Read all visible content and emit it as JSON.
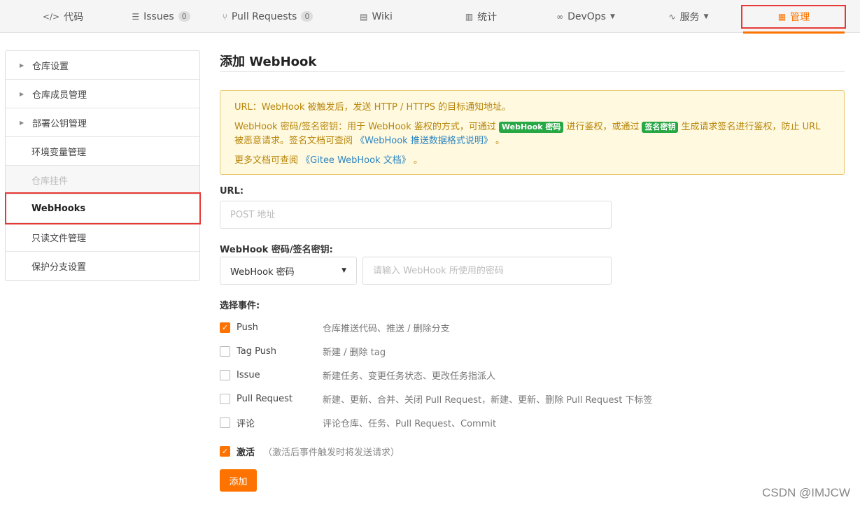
{
  "nav": {
    "items": [
      {
        "icon": "code-icon",
        "glyph": "</>",
        "label": "代码"
      },
      {
        "icon": "issues-icon",
        "glyph": "☰",
        "label": "Issues",
        "badge": "0"
      },
      {
        "icon": "pull-request-icon",
        "glyph": "⑂",
        "label": "Pull Requests",
        "badge": "0"
      },
      {
        "icon": "wiki-icon",
        "glyph": "▤",
        "label": "Wiki"
      },
      {
        "icon": "stats-icon",
        "glyph": "▥",
        "label": "统计"
      },
      {
        "icon": "devops-icon",
        "glyph": "∞",
        "label": "DevOps"
      },
      {
        "icon": "service-icon",
        "glyph": "∿",
        "label": "服务"
      },
      {
        "icon": "manage-icon",
        "glyph": "▦",
        "label": "管理"
      }
    ],
    "active": "管理"
  },
  "sidebar": {
    "items": [
      {
        "label": "仓库设置"
      },
      {
        "label": "仓库成员管理"
      },
      {
        "label": "部署公钥管理"
      },
      {
        "label": "环境变量管理"
      },
      {
        "label": "仓库挂件"
      },
      {
        "label": "WebHooks"
      },
      {
        "label": "只读文件管理"
      },
      {
        "label": "保护分支设置"
      }
    ]
  },
  "main": {
    "title": "添加 WebHook",
    "notice": {
      "line1": "URL：WebHook 被触发后，发送 HTTP / HTTPS 的目标通知地址。",
      "line2_a": "WebHook 密码/签名密钥：用于 WebHook 鉴权的方式，可通过",
      "tag1": "WebHook 密码",
      "line2_b": "进行鉴权，或通过",
      "tag2": "签名密钥",
      "line2_c": "生成请求签名进行鉴权，防止 URL 被恶意请求。签名文档可查阅",
      "link1": "《WebHook 推送数据格式说明》",
      "line2_d": "。",
      "line3_a": "更多文档可查阅",
      "link2": "《Gitee WebHook 文档》",
      "line3_b": "。"
    },
    "url_label": "URL:",
    "url_placeholder": "POST 地址",
    "secret_label": "WebHook 密码/签名密钥:",
    "secret_type": "WebHook 密码",
    "secret_placeholder": "请输入 WebHook 所使用的密码",
    "events_label": "选择事件:",
    "events": [
      {
        "name": "Push",
        "desc": "仓库推送代码、推送 / 删除分支",
        "checked": true
      },
      {
        "name": "Tag Push",
        "desc": "新建 / 删除 tag",
        "checked": false
      },
      {
        "name": "Issue",
        "desc": "新建任务、变更任务状态、更改任务指派人",
        "checked": false
      },
      {
        "name": "Pull Request",
        "desc": "新建、更新、合并、关闭 Pull Request，新建、更新、删除 Pull Request 下标签",
        "checked": false
      },
      {
        "name": "评论",
        "desc": "评论仓库、任务、Pull Request、Commit",
        "checked": false
      }
    ],
    "activate_label": "激活",
    "activate_hint": "（激活后事件触发时将发送请求）",
    "activate_checked": true,
    "add_button": "添加"
  },
  "watermark": "CSDN @IMJCW",
  "colors": {
    "accent": "#fe7300",
    "notice_bg": "#fff9e0",
    "tag_green": "#28a745",
    "highlight_red": "#e53935"
  }
}
